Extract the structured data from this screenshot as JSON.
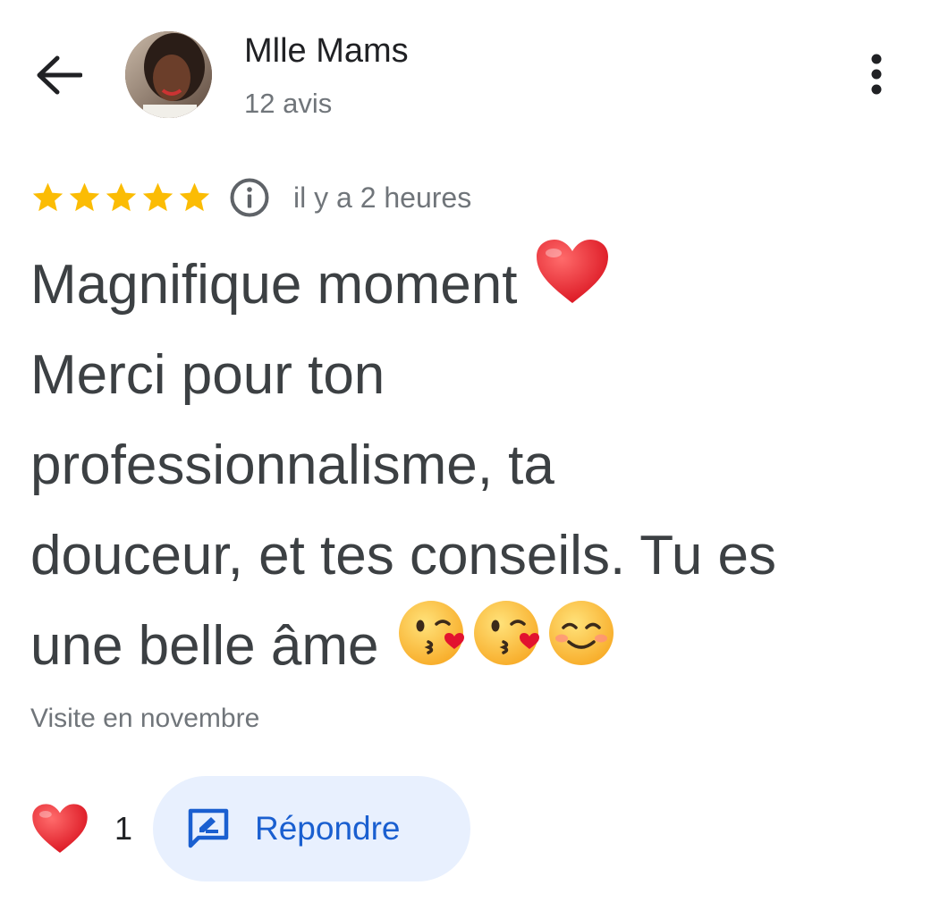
{
  "header": {
    "author_name": "Mlle Mams",
    "author_reviews": "12 avis"
  },
  "review": {
    "rating": 5,
    "rating_max": 5,
    "time_ago": "il y a 2 heures",
    "lines": [
      "Magnifique moment",
      "Merci pour ton",
      "professionnalisme, ta",
      "douceur, et tes conseils. Tu es",
      "une belle âme"
    ],
    "visit": "Visite en novembre"
  },
  "actions": {
    "like_count": "1",
    "reply_label": "Répondre"
  },
  "colors": {
    "star": "#fbbc04",
    "reply_bg": "#e8f0fe",
    "reply_text": "#1a5fd0",
    "heart": "#e2122f"
  },
  "icons": {
    "back": "arrow-back-icon",
    "more": "more-vert-icon",
    "info": "info-icon",
    "like": "heart-icon",
    "reply": "reply-edit-icon"
  }
}
